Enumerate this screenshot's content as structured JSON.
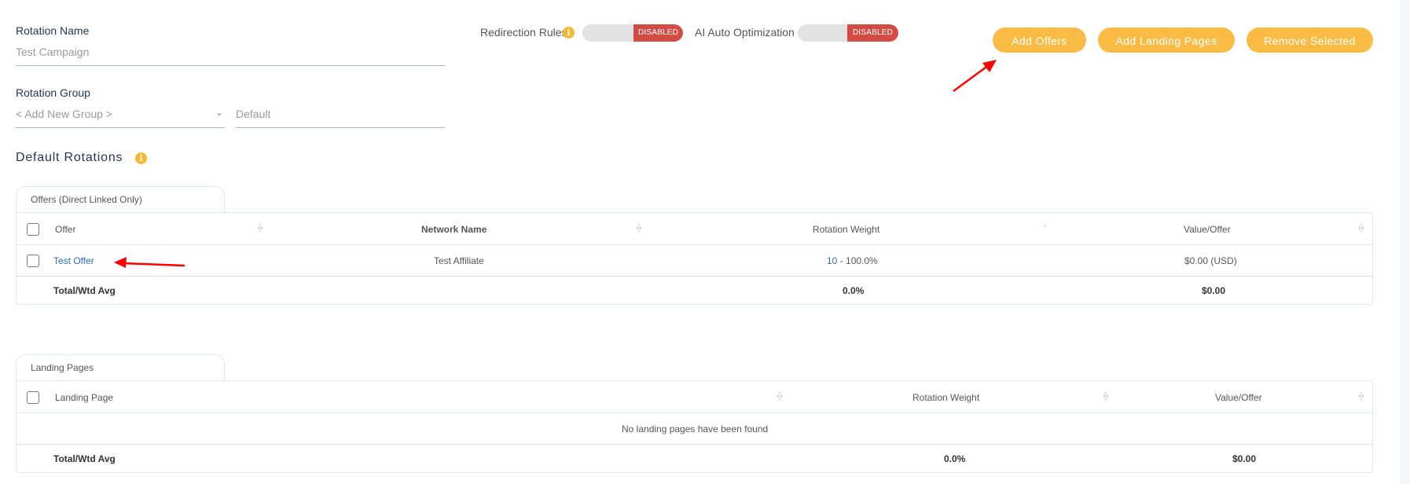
{
  "form": {
    "rotation_name_label": "Rotation Name",
    "rotation_name_value": "Test Campaign",
    "rotation_group_label": "Rotation Group",
    "group_select_value": "< Add New Group >",
    "group_name_placeholder": "Default"
  },
  "toggles": {
    "redirection_rules_label": "Redirection Rules",
    "redirection_rules_state": "DISABLED",
    "ai_auto_optimization_label": "AI Auto Optimization",
    "ai_auto_optimization_state": "DISABLED"
  },
  "actions": {
    "add_offers": "Add Offers",
    "add_landing_pages": "Add Landing Pages",
    "remove_selected": "Remove Selected"
  },
  "section": {
    "title": "Default Rotations"
  },
  "offers_table": {
    "tab_label": "Offers (Direct Linked Only)",
    "columns": [
      "Offer",
      "Network Name",
      "Rotation Weight",
      "Value/Offer"
    ],
    "rows": [
      {
        "offer": "Test Offer",
        "network": "Test Affiliate",
        "weight": "10",
        "weight_pct": " - 100.0%",
        "value": "$0.00 (USD)"
      }
    ],
    "total": {
      "label": "Total/Wtd Avg",
      "weight": "0.0%",
      "value": "$0.00"
    }
  },
  "landing_table": {
    "tab_label": "Landing Pages",
    "columns": [
      "Landing Page",
      "Rotation Weight",
      "Value/Offer"
    ],
    "empty_message": "No landing pages have been found",
    "total": {
      "label": "Total/Wtd Avg",
      "weight": "0.0%",
      "value": "$0.00"
    }
  },
  "icons": {
    "info": "info-icon",
    "sort": "sort-icon",
    "sort_up": "sort-asc-icon",
    "chevron": "chevron-down-icon"
  },
  "colors": {
    "accent_button": "#fabb45",
    "disabled_badge": "#d24c43",
    "link": "#2b6cb0",
    "info": "#f7b733",
    "annotation_arrow": "#ff0000"
  }
}
